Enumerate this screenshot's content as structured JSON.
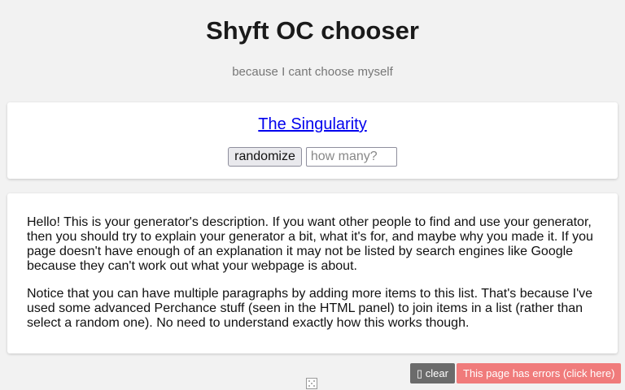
{
  "header": {
    "title": "Shyft OC chooser",
    "subtitle": "because I cant choose myself"
  },
  "output": {
    "result": "The Singularity",
    "randomize_label": "randomize",
    "count_placeholder": "how many?"
  },
  "description": {
    "paragraphs": [
      "Hello! This is your generator's description. If you want other people to find and use your generator, then you should try to explain your generator a bit, what it's for, and maybe why you made it. If you page doesn't have enough of an explanation it may not be listed by search engines like Google because they can't work out what your webpage is about.",
      "Notice that you can have multiple paragraphs by adding more items to this list. That's because I've used some advanced Perchance stuff (seen in the HTML panel) to join items in a list (rather than select a random one). No need to understand exactly how this works though."
    ]
  },
  "footer": {
    "clear_icon": "▯",
    "clear_label": "clear",
    "errors_label": "This page has errors (click here)",
    "dice_icon_name": "dice-icon"
  },
  "colors": {
    "link": "#0000ee",
    "errors_bg": "#f07b7b",
    "clear_bg": "#6b6b6b"
  }
}
